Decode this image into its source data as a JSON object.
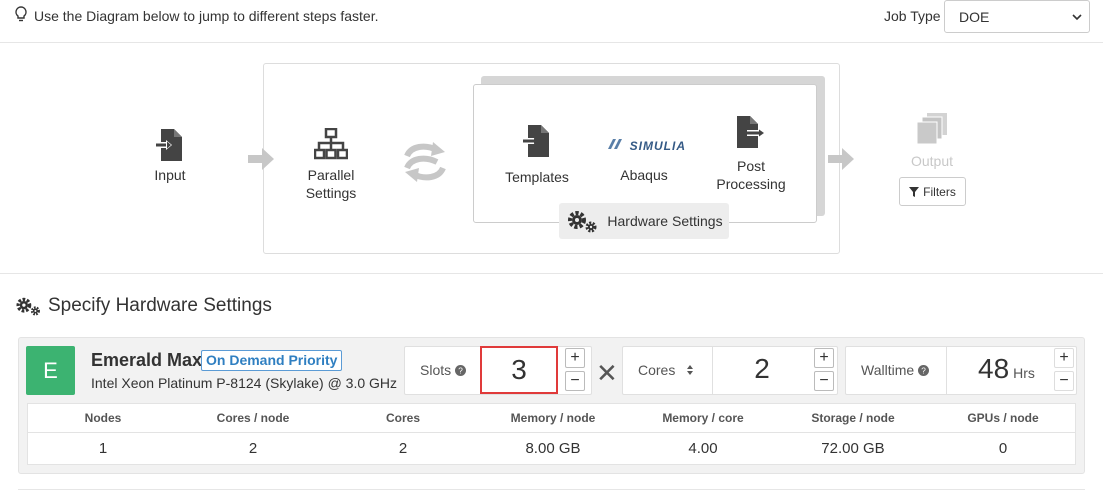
{
  "header": {
    "hint_text": "Use the Diagram below to jump to different steps faster.",
    "job_type_label": "Job Type",
    "job_type_value": "DOE"
  },
  "diagram": {
    "input_label": "Input",
    "parallel_label_line1": "Parallel",
    "parallel_label_line2": "Settings",
    "templates_label": "Templates",
    "simulia_logo_text": "SIMULIA",
    "abaqus_label": "Abaqus",
    "post_label_line1": "Post",
    "post_label_line2": "Processing",
    "hardware_settings_label": "Hardware Settings",
    "output_label": "Output",
    "filters_label": "Filters"
  },
  "section": {
    "title": "Specify Hardware Settings"
  },
  "hardware": {
    "logo_letter": "E",
    "name": "Emerald Max",
    "priority": "On Demand Priority",
    "cpu": "Intel Xeon Platinum P-8124 (Skylake) @ 3.0 GHz",
    "slots_label": "Slots",
    "slots_value": "3",
    "cores_label": "Cores",
    "cores_value": "2",
    "walltime_label": "Walltime",
    "walltime_value": "48",
    "walltime_unit": "Hrs",
    "plus": "+",
    "minus": "−",
    "times": "✕"
  },
  "table": {
    "headers": [
      "Nodes",
      "Cores / node",
      "Cores",
      "Memory / node",
      "Memory / core",
      "Storage / node",
      "GPUs / node"
    ],
    "values": [
      "1",
      "2",
      "2",
      "8.00 GB",
      "4.00",
      "72.00 GB",
      "0"
    ]
  },
  "colors": {
    "accent_green": "#3cb371",
    "priority_blue": "#2f7fc1",
    "highlight_red": "#e03a3a"
  }
}
